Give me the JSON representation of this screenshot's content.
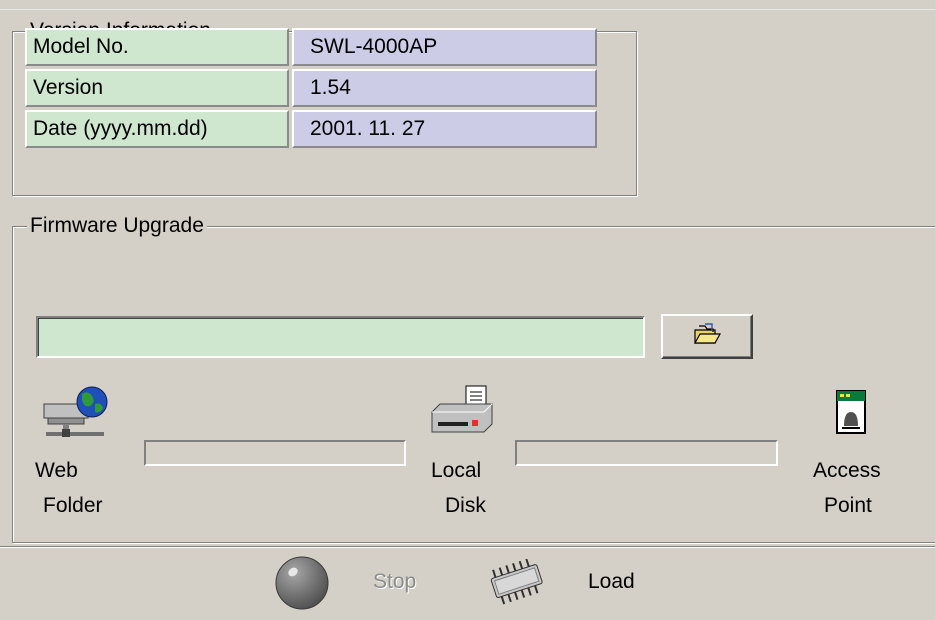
{
  "version_info": {
    "title": "Version Information",
    "rows": [
      {
        "label": "Model No.",
        "value": "SWL-4000AP"
      },
      {
        "label": "Version",
        "value": "1.54"
      },
      {
        "label": "Date (yyyy.mm.dd)",
        "value": "2001. 11. 27"
      }
    ]
  },
  "firmware": {
    "title": "Firmware Upgrade",
    "path_value": "",
    "devices": {
      "web_folder": {
        "line1": "Web",
        "line2": "Folder",
        "icon": "web-folder-icon"
      },
      "local_disk": {
        "line1": "Local",
        "line2": "Disk",
        "icon": "local-disk-icon"
      },
      "access_point": {
        "line1": "Access",
        "line2": "Point",
        "icon": "access-point-icon"
      }
    },
    "progress": {
      "web_to_local": 0,
      "local_to_ap": 0
    }
  },
  "actions": {
    "stop_label": "Stop",
    "load_label": "Load",
    "stop_enabled": false
  }
}
